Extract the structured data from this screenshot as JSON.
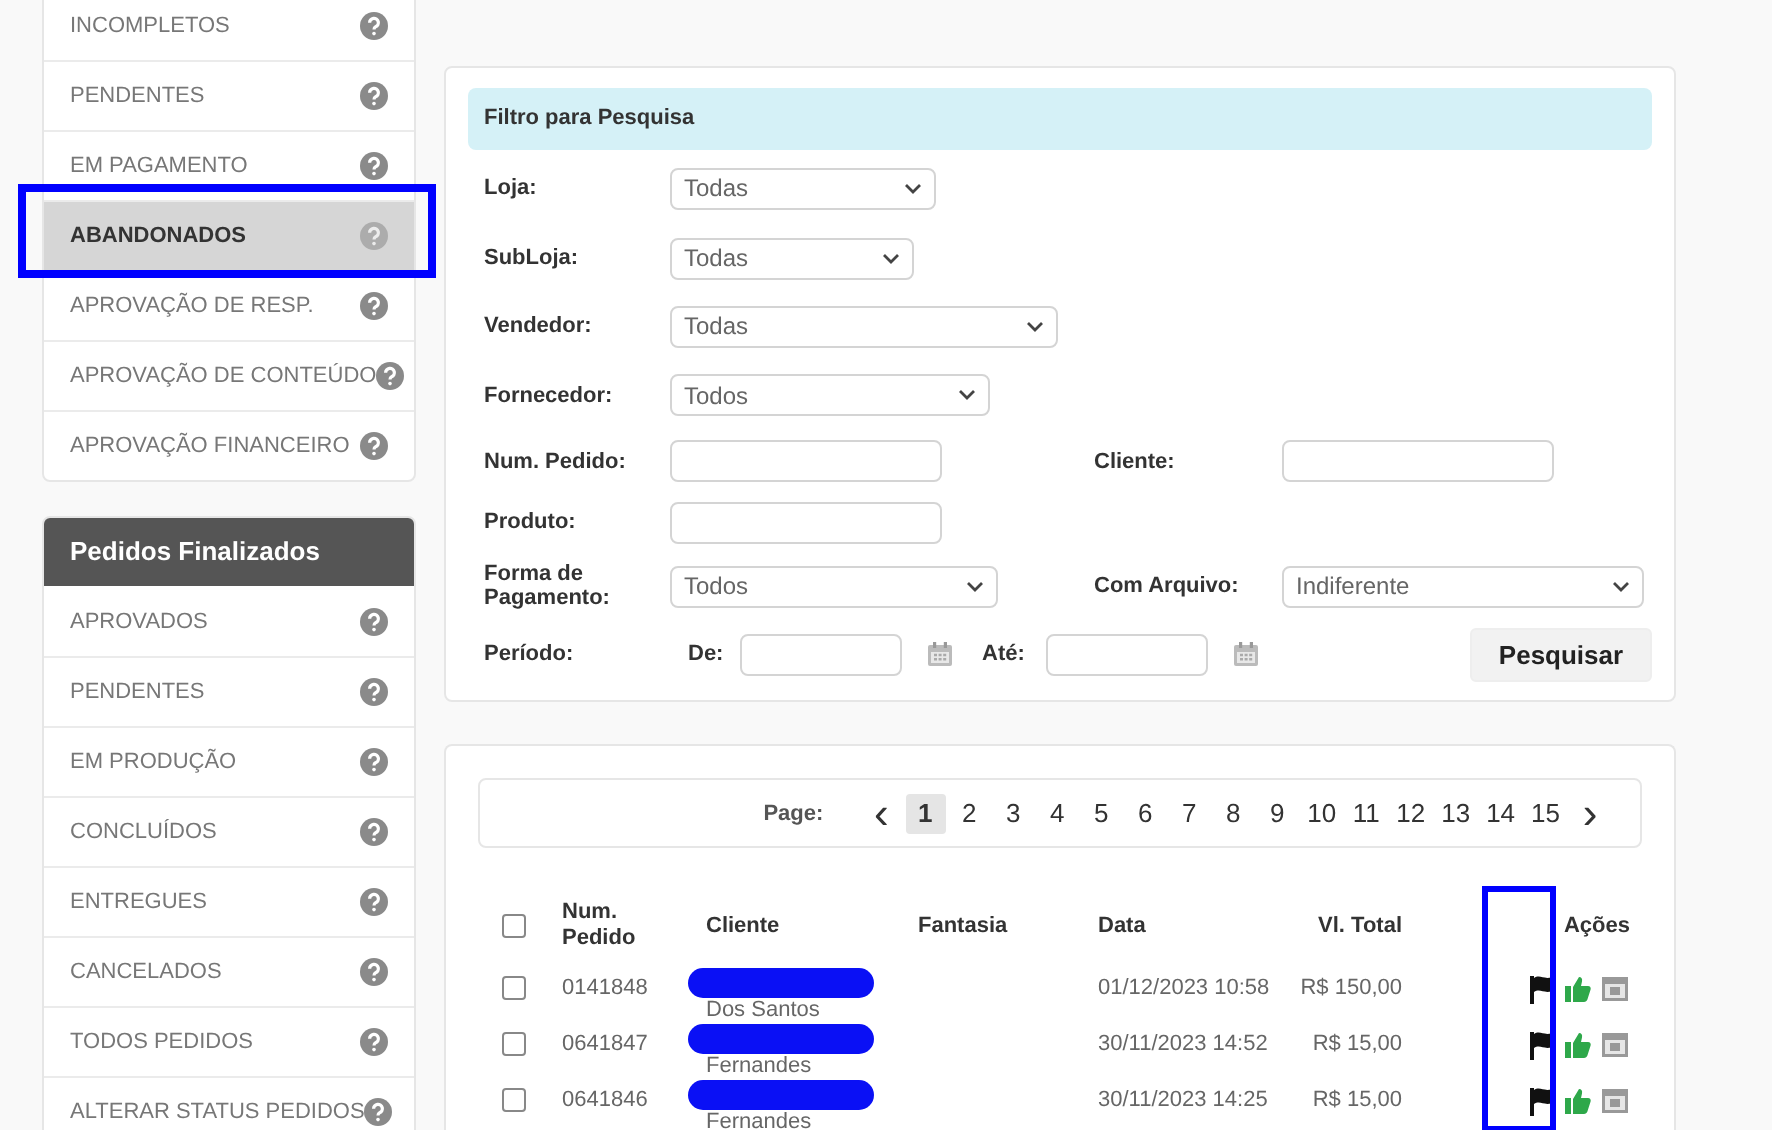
{
  "sidebar": {
    "groups": [
      {
        "items": [
          {
            "label": "INCOMPLETOS",
            "selected": false
          },
          {
            "label": "PENDENTES",
            "selected": false
          },
          {
            "label": "EM PAGAMENTO",
            "selected": false
          },
          {
            "label": "ABANDONADOS",
            "selected": true,
            "highlighted": true
          },
          {
            "label": "APROVAÇÃO DE RESP.",
            "selected": false
          },
          {
            "label": "APROVAÇÃO DE CONTEÚDO",
            "selected": false
          },
          {
            "label": "APROVAÇÃO FINANCEIRO",
            "selected": false
          }
        ]
      },
      {
        "title": "Pedidos Finalizados",
        "items": [
          {
            "label": "APROVADOS",
            "selected": false
          },
          {
            "label": "PENDENTES",
            "selected": false
          },
          {
            "label": "EM PRODUÇÃO",
            "selected": false
          },
          {
            "label": "CONCLUÍDOS",
            "selected": false
          },
          {
            "label": "ENTREGUES",
            "selected": false
          },
          {
            "label": "CANCELADOS",
            "selected": false
          },
          {
            "label": "TODOS PEDIDOS",
            "selected": false
          },
          {
            "label": "ALTERAR STATUS PEDIDOS",
            "selected": false
          }
        ]
      }
    ]
  },
  "filter": {
    "title": "Filtro para Pesquisa",
    "rows": [
      {
        "label": "Loja:",
        "field": {
          "kind": "select",
          "value": "Todas"
        }
      },
      {
        "label": "SubLoja:",
        "field": {
          "kind": "select",
          "value": "Todas"
        }
      },
      {
        "label": "Vendedor:",
        "field": {
          "kind": "select",
          "value": "Todas"
        }
      },
      {
        "label": "Fornecedor:",
        "field": {
          "kind": "select",
          "value": "Todos"
        }
      },
      {
        "label": "Num. Pedido:",
        "field": {
          "kind": "input"
        },
        "right": {
          "label": "Cliente:",
          "field": {
            "kind": "input"
          }
        }
      },
      {
        "label": "Produto:",
        "field": {
          "kind": "input"
        }
      },
      {
        "label": "Forma de Pagamento:",
        "field": {
          "kind": "select",
          "value": "Todos"
        },
        "right": {
          "label": "Com Arquivo:",
          "field": {
            "kind": "select",
            "value": "Indiferente"
          }
        }
      }
    ],
    "period": {
      "label": "Período:",
      "from_label": "De:",
      "to_label": "Até:"
    },
    "search_button": "Pesquisar"
  },
  "pagination": {
    "label": "Page:",
    "prev": "‹",
    "next": "›",
    "pages": [
      {
        "label": "1",
        "selected": true
      },
      {
        "label": "2",
        "selected": false
      },
      {
        "label": "3",
        "selected": false
      },
      {
        "label": "4",
        "selected": false
      },
      {
        "label": "5",
        "selected": false
      },
      {
        "label": "6",
        "selected": false
      },
      {
        "label": "7",
        "selected": false
      },
      {
        "label": "8",
        "selected": false
      },
      {
        "label": "9",
        "selected": false
      },
      {
        "label": "10",
        "selected": false
      },
      {
        "label": "11",
        "selected": false
      },
      {
        "label": "12",
        "selected": false
      },
      {
        "label": "13",
        "selected": false
      },
      {
        "label": "14",
        "selected": false
      },
      {
        "label": "15",
        "selected": false
      }
    ]
  },
  "table": {
    "columns": [
      "Num. Pedido",
      "Cliente",
      "Fantasia",
      "Data",
      "Vl. Total",
      "Ações"
    ],
    "all_checked": false,
    "actions_highlighted": true,
    "rows": [
      {
        "checked": false,
        "number": "0141848",
        "client": "Dos Santos",
        "client_redacted": true,
        "date": "01/12/2023 10:58",
        "total": "R$ 150,00"
      },
      {
        "checked": false,
        "number": "0641847",
        "client": "Fernandes",
        "client_redacted": true,
        "date": "30/11/2023 14:52",
        "total": "R$ 15,00"
      },
      {
        "checked": false,
        "number": "0641846",
        "client": "Fernandes",
        "client_redacted": true,
        "date": "30/11/2023 14:25",
        "total": "R$ 15,00"
      }
    ]
  }
}
